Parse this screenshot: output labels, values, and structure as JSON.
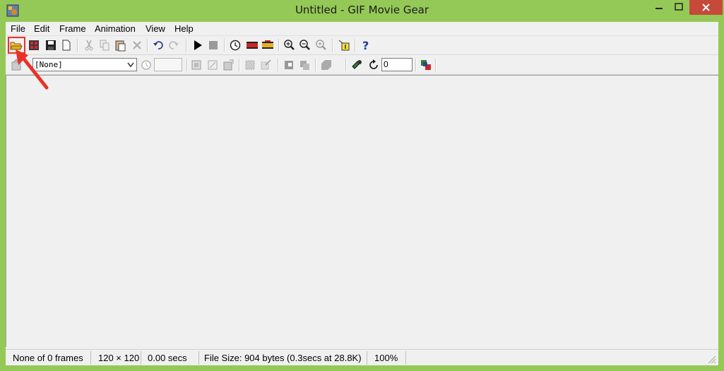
{
  "window": {
    "title": "Untitled - GIF Movie Gear"
  },
  "menu": [
    "File",
    "Edit",
    "Frame",
    "Animation",
    "View",
    "Help"
  ],
  "toolbar2": {
    "transparency_select": "[None]",
    "loop_count": "0"
  },
  "status": {
    "frames": "None of 0 frames",
    "dimensions": "120 × 120",
    "time": "0.00 secs",
    "file_size": "File Size: 904 bytes  (0.3secs at 28.8K)",
    "zoom": "100%"
  },
  "colors": {
    "frame": "#95c957",
    "close": "#c7493a",
    "highlight": "#e8312a"
  }
}
